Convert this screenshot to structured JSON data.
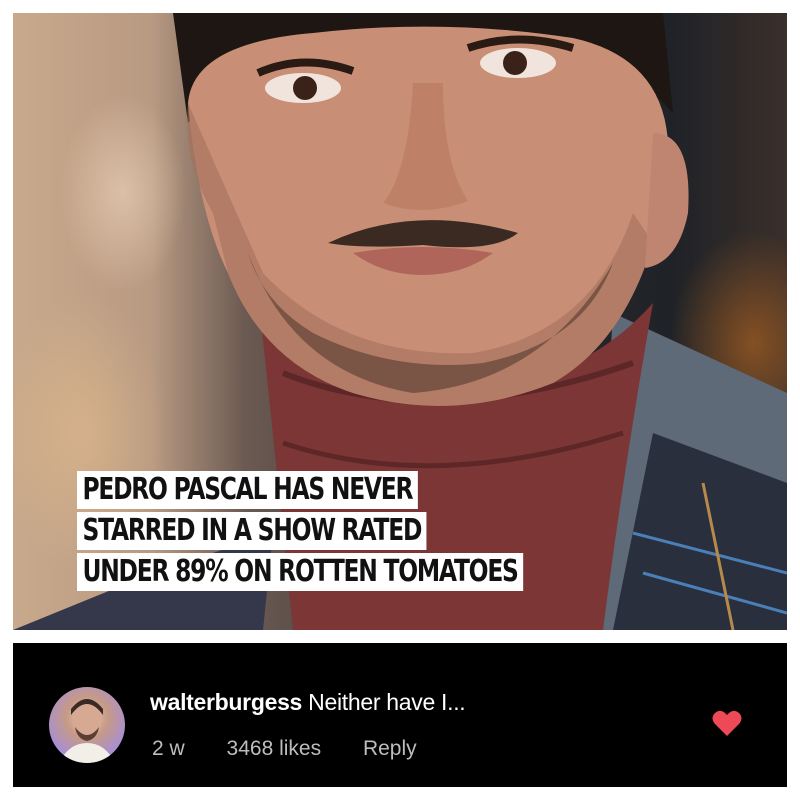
{
  "post": {
    "headline_lines": [
      "PEDRO PASCAL HAS NEVER",
      "STARRED IN A SHOW RATED",
      "UNDER 89% ON ROTTEN TOMATOES"
    ]
  },
  "comment": {
    "username": "walterburgess",
    "text": "Neither have I...",
    "age": "2 w",
    "likes": "3468 likes",
    "reply_label": "Reply",
    "heart_icon": "heart-icon",
    "heart_color": "#ed4956"
  },
  "colors": {
    "comment_bg": "#000000",
    "headline_bg": "#ffffff",
    "meta_text": "#bdbdbd"
  }
}
